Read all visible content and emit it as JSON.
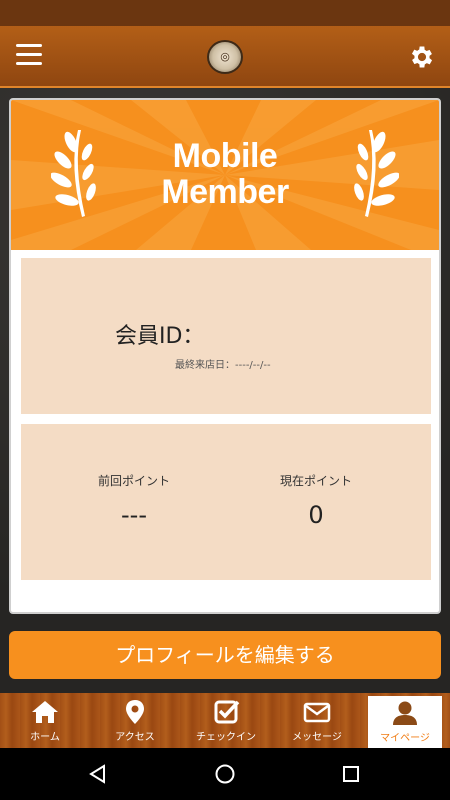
{
  "header": {
    "menu_icon": "hamburger-menu-icon",
    "logo_icon": "shop-logo-icon",
    "settings_icon": "gear-icon"
  },
  "banner": {
    "title_line1": "Mobile",
    "title_line2": "Member",
    "decoration_icon": "laurel-wreath-icon",
    "color": "#f6901e"
  },
  "member": {
    "id_label": "会員ID：",
    "last_visit_label": "最終来店日：----/--/--"
  },
  "points": {
    "previous_label": "前回ポイント",
    "previous_value": "---",
    "current_label": "現在ポイント",
    "current_value": "0"
  },
  "edit_profile_button": "プロフィールを編集する",
  "tabs": [
    {
      "label": "ホーム",
      "icon": "home-icon",
      "active": false
    },
    {
      "label": "アクセス",
      "icon": "map-pin-icon",
      "active": false
    },
    {
      "label": "チェックイン",
      "icon": "checkbox-icon",
      "active": false
    },
    {
      "label": "メッセージ",
      "icon": "envelope-icon",
      "active": false
    },
    {
      "label": "マイページ",
      "icon": "person-icon",
      "active": true
    }
  ],
  "system_nav": {
    "back_icon": "back-triangle-icon",
    "home_icon": "home-circle-icon",
    "recent_icon": "recent-apps-icon"
  },
  "colors": {
    "accent": "#f7901e",
    "header_brown": "#a0521a",
    "panel_bg": "#f4dcc5"
  }
}
